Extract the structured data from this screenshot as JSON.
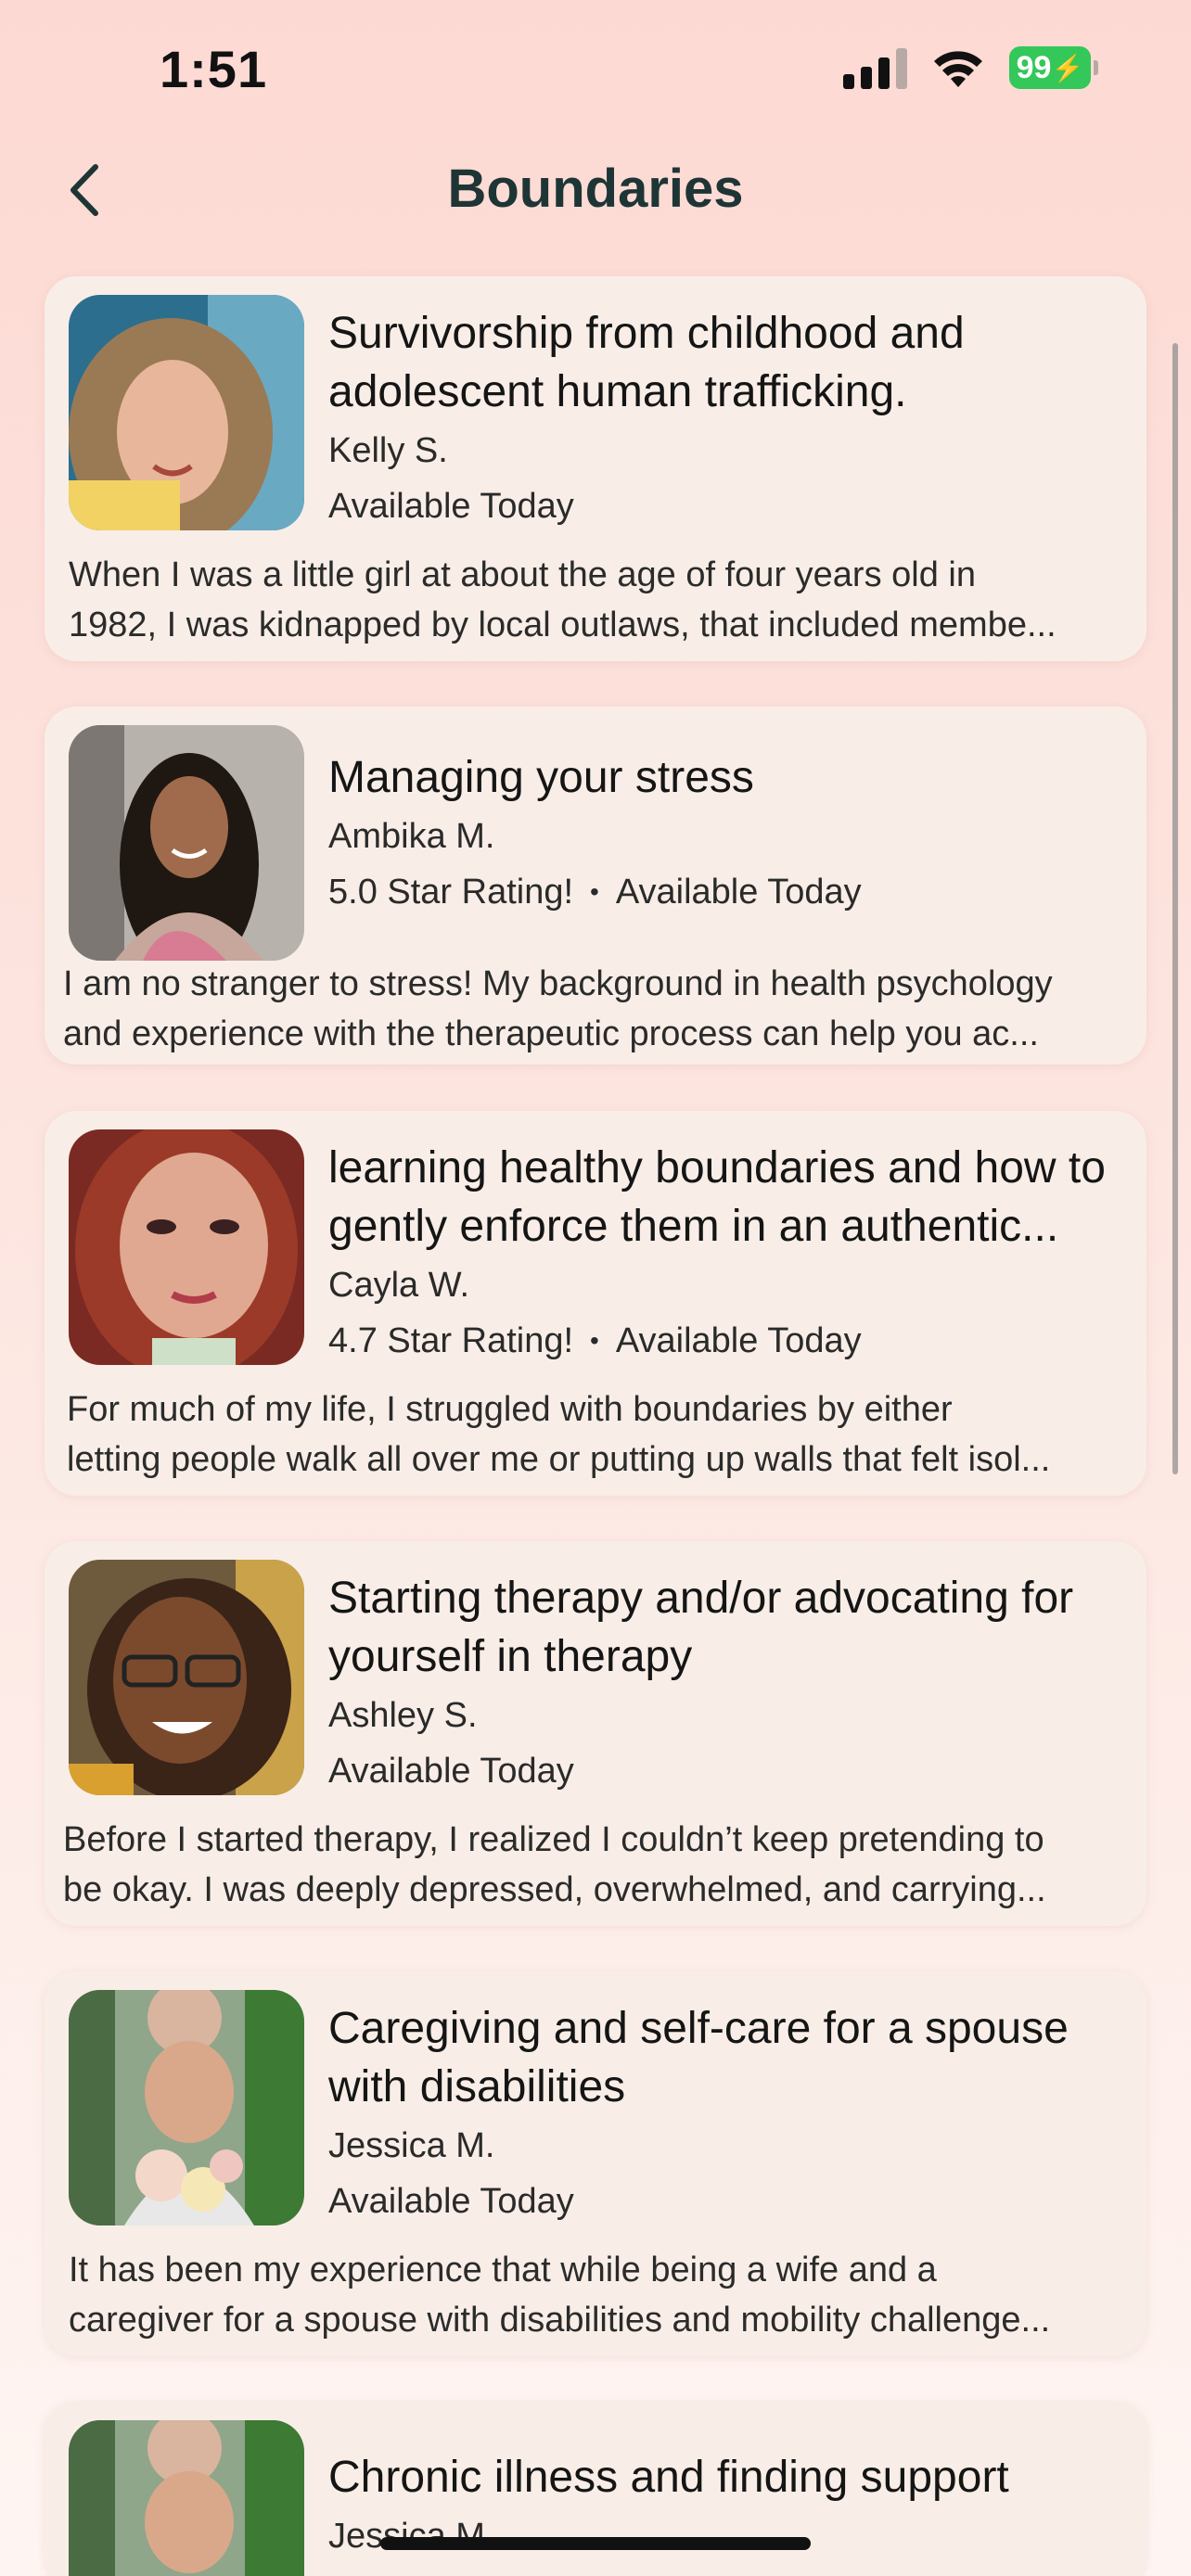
{
  "status": {
    "time": "1:51",
    "battery": "99"
  },
  "header": {
    "title": "Boundaries"
  },
  "cards": [
    {
      "title": "Survivorship from childhood and adolescent human trafficking.",
      "author": "Kelly S.",
      "rating": "",
      "availability": "Available Today",
      "desc1": "When I was a little girl at about the age of four years old in",
      "desc2": "1982, I was kidnapped by local outlaws, that included membe..."
    },
    {
      "title": "Managing your stress",
      "author": "Ambika M.",
      "rating": "5.0 Star Rating!",
      "availability": "Available Today",
      "desc1": "I am no stranger to stress! My background in health psychology",
      "desc2": "and experience with the therapeutic process can help you ac..."
    },
    {
      "title": "learning healthy boundaries and how to gently enforce them in an authentic...",
      "author": "Cayla W.",
      "rating": "4.7 Star Rating!",
      "availability": "Available Today",
      "desc1": "For much of my life, I struggled with boundaries by either",
      "desc2": "letting people walk all over me or putting up walls that felt isol..."
    },
    {
      "title": "Starting therapy and/or advocating for yourself in therapy",
      "author": "Ashley S.",
      "rating": "",
      "availability": "Available Today",
      "desc1": "Before I started therapy, I realized I couldn’t keep pretending to",
      "desc2": "be okay. I was deeply depressed, overwhelmed, and carrying..."
    },
    {
      "title": "Caregiving and self-care for a spouse with disabilities",
      "author": "Jessica M.",
      "rating": "",
      "availability": "Available Today",
      "desc1": "It has been my experience that while being a wife and a",
      "desc2": "caregiver for a spouse with disabilities and mobility challenge..."
    },
    {
      "title": "Chronic illness and finding support",
      "author": "Jessica M.",
      "rating": "",
      "availability": "",
      "desc1": "",
      "desc2": ""
    }
  ]
}
